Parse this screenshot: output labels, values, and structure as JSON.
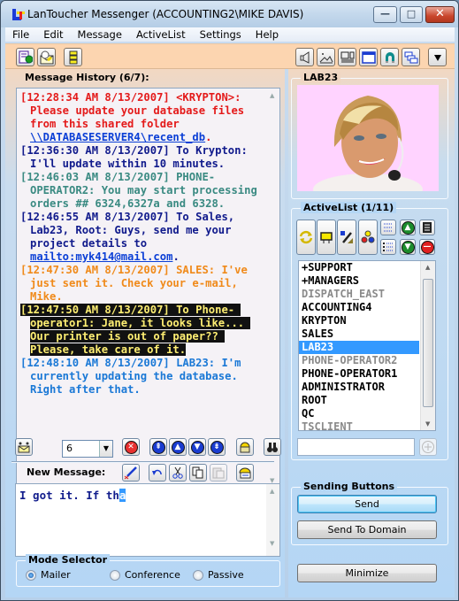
{
  "window": {
    "title": "LanToucher Messenger (ACCOUNTING2\\MIKE DAVIS)",
    "controls": {
      "minimize": "—",
      "maximize": "□",
      "close": "✕"
    }
  },
  "menu": [
    "File",
    "Edit",
    "Message",
    "ActiveList",
    "Settings",
    "Help"
  ],
  "toolbar": {
    "left_icons": [
      "new-message-icon",
      "scheduled-mail-icon",
      "list-view-icon"
    ],
    "right_icons": [
      "speaker-icon",
      "picture-icon",
      "layout-icon",
      "window-icon",
      "magnet-icon",
      "cascade-windows-icon",
      "dropdown-arrow-icon"
    ]
  },
  "history": {
    "label": "Message History (6/7):",
    "messages": [
      {
        "head": "[12:28:34 AM 8/13/2007] <KRYPTON>:",
        "body": "Please update your database files from this shared folder ",
        "link": "\\\\DATABASESERVER4\\recent_db",
        "tail": ".",
        "color": "#e41a1a",
        "link_color": "#0b3fd6"
      },
      {
        "head": "[12:36:30 AM 8/13/2007] To",
        "body": "Krypton: I'll update within 10 minutes.",
        "color": "#101a8c"
      },
      {
        "head": "[12:46:03 AM 8/13/2007] PHONE-",
        "body": "OPERATOR2: You may start processing orders ## 6324,6327a and 6328.",
        "color": "#3a8a82"
      },
      {
        "head": "[12:46:55 AM 8/13/2007] To Sales,",
        "body": "Lab23, Root: Guys, send me your project details to ",
        "link": "mailto:myk414@mail.com",
        "tail": ".",
        "color": "#101a8c",
        "link_color": "#0b3fd6"
      },
      {
        "head": "[12:47:30 AM 8/13/2007] SALES:",
        "body": "I've just sent it. Check your e-mail, Mike.",
        "color": "#f08a1a"
      },
      {
        "head": "[12:47:50 AM 8/13/2007] To Phone-",
        "body": "operator1: Jane, it looks like... Our printer is out of paper?? Please, take care of it.",
        "color": "#ffef73",
        "highlight": true
      },
      {
        "head": "[12:48:10 AM 8/13/2007] LAB23: I'm",
        "body": "currently updating the database. Right after that.",
        "color": "#1a78d6"
      }
    ]
  },
  "history_controls": {
    "count_value": "6",
    "icons": [
      "mail-notify-icon",
      "delete-icon",
      "first-icon",
      "previous-icon",
      "next-icon",
      "last-icon",
      "archive-icon",
      "find-icon"
    ]
  },
  "new_message": {
    "label": "New Message:",
    "value_before_selection": "I got it. If th",
    "value_selected": "a",
    "icons": [
      "pen-icon",
      "undo-icon",
      "cut-icon",
      "copy-icon",
      "paste-icon",
      "attach-icon"
    ]
  },
  "mode_selector": {
    "label": "Mode Selector",
    "options": [
      {
        "label": "Mailer",
        "checked": true
      },
      {
        "label": "Conference",
        "checked": false
      },
      {
        "label": "Passive",
        "checked": false
      }
    ]
  },
  "contact": {
    "name": "LAB23",
    "photo_alt": "Contact photo of LAB23"
  },
  "activelist": {
    "label": "ActiveList (1/11)",
    "items": [
      {
        "name": "+SUPPORT",
        "state": "normal"
      },
      {
        "name": "+MANAGERS",
        "state": "normal"
      },
      {
        "name": "DISPATCH_EAST",
        "state": "offline"
      },
      {
        "name": "ACCOUNTING4",
        "state": "normal"
      },
      {
        "name": "KRYPTON",
        "state": "normal"
      },
      {
        "name": "SALES",
        "state": "normal"
      },
      {
        "name": "LAB23",
        "state": "selected"
      },
      {
        "name": "PHONE-OPERATOR2",
        "state": "offline"
      },
      {
        "name": "PHONE-OPERATOR1",
        "state": "normal"
      },
      {
        "name": "ADMINISTRATOR",
        "state": "normal"
      },
      {
        "name": "ROOT",
        "state": "normal"
      },
      {
        "name": "QC",
        "state": "normal"
      },
      {
        "name": "TSCLIENT",
        "state": "offline"
      }
    ],
    "add_input_value": ""
  },
  "sending": {
    "label": "Sending Buttons",
    "send": "Send",
    "send_to_domain": "Send To Domain"
  },
  "minimize_label": "Minimize"
}
